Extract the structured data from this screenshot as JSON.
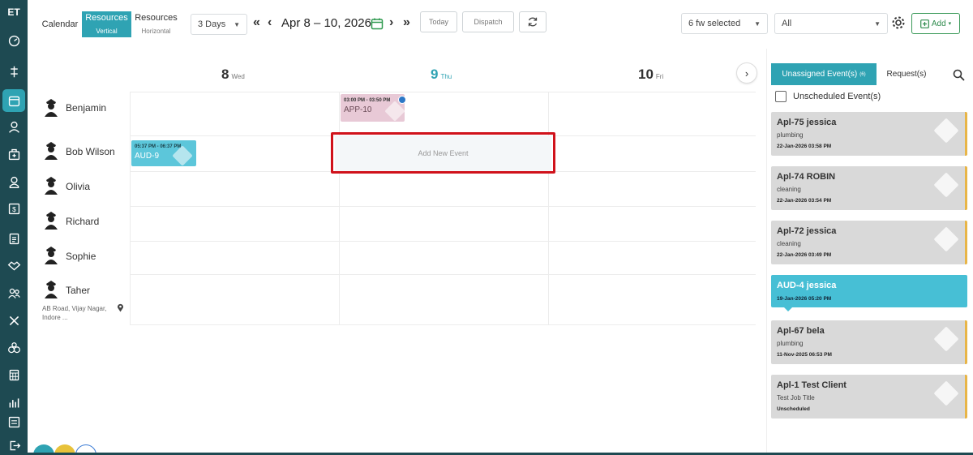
{
  "sidebar": {
    "logo": "ET",
    "items": [
      {
        "icon": "dashboard-icon"
      },
      {
        "icon": "routes-icon"
      },
      {
        "icon": "calendar-icon",
        "active": true
      },
      {
        "icon": "team-icon"
      },
      {
        "icon": "briefcase-icon"
      },
      {
        "icon": "user-icon"
      },
      {
        "icon": "dollar-icon"
      },
      {
        "icon": "document-icon"
      },
      {
        "icon": "handshake-icon"
      },
      {
        "icon": "users-icon"
      },
      {
        "icon": "tools-icon"
      },
      {
        "icon": "group-icon"
      },
      {
        "icon": "calculator-icon"
      },
      {
        "icon": "reports-icon"
      },
      {
        "icon": "forms-icon"
      },
      {
        "icon": "logout-icon"
      }
    ]
  },
  "toolbar": {
    "calendar_label": "Calendar",
    "resources_vertical_label": "Resources",
    "resources_vertical_sub": "Vertical",
    "resources_horizontal_label": "Resources",
    "resources_horizontal_sub": "Horizontal",
    "days_select": "3 Days",
    "date_range": "Apr 8 – 10, 2026",
    "today_label": "Today",
    "dispatch_label": "Dispatch",
    "fw_selected": "6 fw selected",
    "filter_all": "All",
    "add_label": "Add"
  },
  "days": [
    {
      "num": "8",
      "name": "Wed",
      "today": false
    },
    {
      "num": "9",
      "name": "Thu",
      "today": true
    },
    {
      "num": "10",
      "name": "Fri",
      "today": false
    }
  ],
  "resources": [
    {
      "name": "Benjamin"
    },
    {
      "name": "Bob Wilson"
    },
    {
      "name": "Olivia"
    },
    {
      "name": "Richard"
    },
    {
      "name": "Sophie"
    },
    {
      "name": "Taher",
      "address": "AB Road, Vijay Nagar, Indore ..."
    }
  ],
  "events": [
    {
      "time": "03:00 PM - 03:50 PM",
      "code": "APP-10",
      "resource": "Benjamin",
      "day": "Thu"
    },
    {
      "time": "05:37 PM - 06:37 PM",
      "code": "AUD-9",
      "resource": "Bob Wilson",
      "day": "Wed"
    }
  ],
  "add_event_label": "Add New Event",
  "panel": {
    "tab_unassigned": "Unassigned Event(s)",
    "tab_unassigned_count": "(6)",
    "tab_requests": "Request(s)",
    "unscheduled_label": "Unscheduled Event(s)",
    "cards": [
      {
        "title": "Apl-75 jessica",
        "type": "plumbing",
        "date": "22-Jan-2026 03:58 PM"
      },
      {
        "title": "Apl-74 ROBIN",
        "type": "cleaning",
        "date": "22-Jan-2026 03:54 PM"
      },
      {
        "title": "Apl-72 jessica",
        "type": "cleaning",
        "date": "22-Jan-2026 03:49 PM"
      },
      {
        "title": "AUD-4 jessica",
        "type": "",
        "date": "19-Jan-2026 05:20 PM"
      },
      {
        "title": "Apl-67 bela",
        "type": "plumbing",
        "date": "11-Nov-2025 06:53 PM"
      },
      {
        "title": "Apl-1 Test Client",
        "type": "Test Job Title",
        "date": "Unscheduled"
      }
    ]
  },
  "colors": {
    "sidebar": "#1e4a52",
    "accent": "#2fa3b3",
    "highlight": "#d0121b",
    "event_pink": "#e8c9d6",
    "event_teal": "#5cc6da"
  }
}
